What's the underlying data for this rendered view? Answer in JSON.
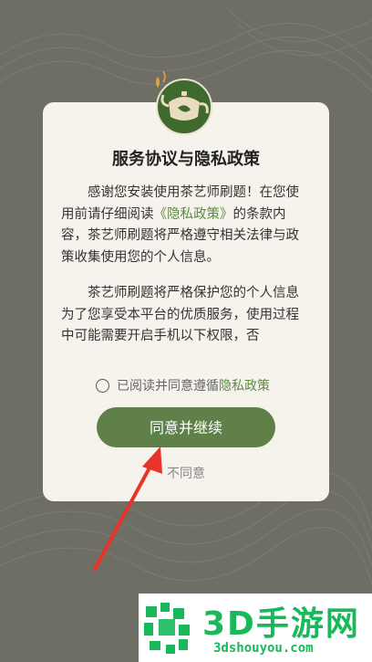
{
  "dialog": {
    "title": "服务协议与隐私政策",
    "para1_before": "感谢您安装使用茶艺师刷题！在您使用前请仔细阅读",
    "para1_link": "《隐私政策》",
    "para1_after": "的条款内容，茶艺师刷题将严格遵守相关法律与政策收集使用您的个人信息。",
    "para2": "茶艺师刷题将严格保护您的个人信息为了您享受本平台的优质服务，使用过程中可能需要开启手机以下权限，否",
    "agree_prefix": "已阅读并同意遵循",
    "agree_link": "隐私政策",
    "continue_label": "同意并继续",
    "disagree_label": "不同意"
  },
  "watermark": {
    "title": "3D手游网",
    "url": "3dshouyou.com"
  },
  "colors": {
    "background": "#6f6e64",
    "accent": "#5f8049",
    "link": "#5e8a45",
    "watermark": "#19b85a"
  }
}
